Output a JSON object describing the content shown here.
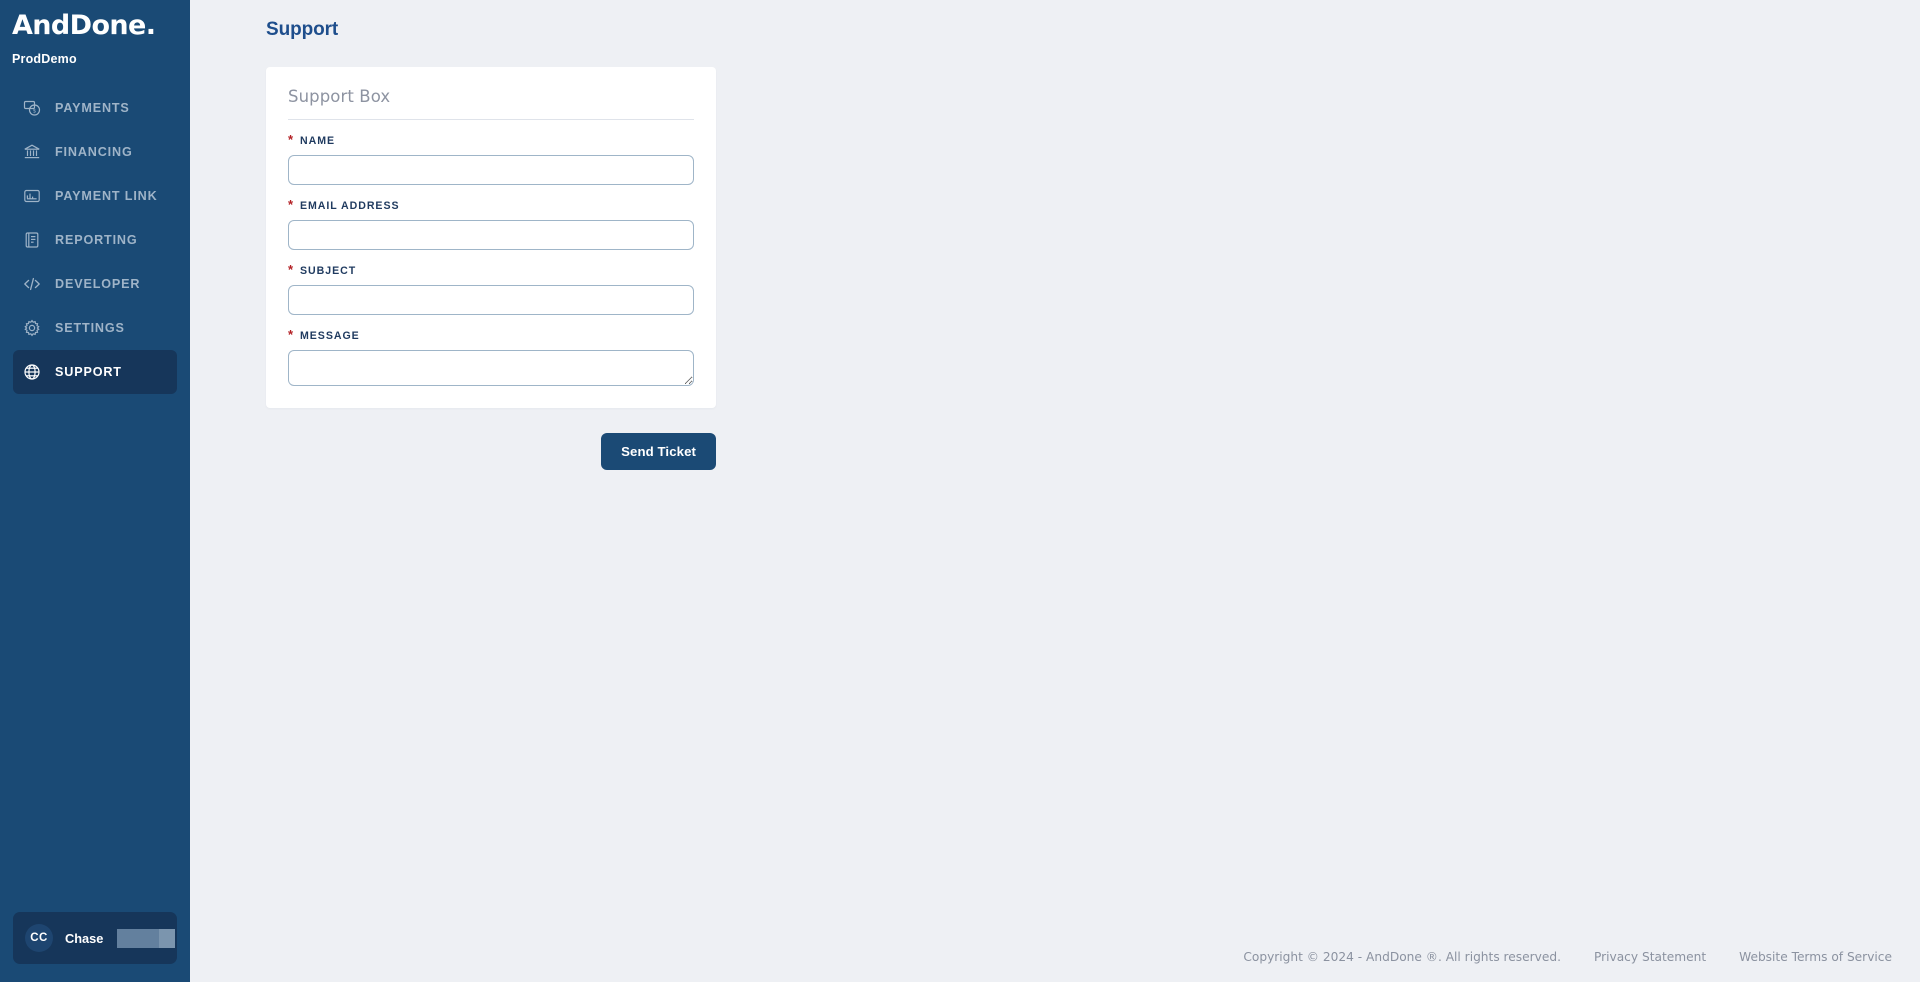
{
  "sidebar": {
    "logo": "AndDone.",
    "org_name": "ProdDemo",
    "items": [
      {
        "label": "PAYMENTS",
        "icon": "payments-icon",
        "active": false
      },
      {
        "label": "FINANCING",
        "icon": "bank-icon",
        "active": false
      },
      {
        "label": "PAYMENT LINK",
        "icon": "payment-link-icon",
        "active": false
      },
      {
        "label": "REPORTING",
        "icon": "report-icon",
        "active": false
      },
      {
        "label": "DEVELOPER",
        "icon": "code-icon",
        "active": false
      },
      {
        "label": "SETTINGS",
        "icon": "gear-icon",
        "active": false
      },
      {
        "label": "SUPPORT",
        "icon": "globe-icon",
        "active": true
      }
    ],
    "profile": {
      "initials": "CC",
      "name": "Chase",
      "redacted": ""
    }
  },
  "main": {
    "page_title": "Support",
    "card": {
      "title": "Support Box",
      "fields": [
        {
          "label": "NAME",
          "required": "*",
          "value": "",
          "placeholder": ""
        },
        {
          "label": "EMAIL ADDRESS",
          "required": "*",
          "value": "",
          "placeholder": ""
        },
        {
          "label": "SUBJECT",
          "required": "*",
          "value": "",
          "placeholder": ""
        },
        {
          "label": "MESSAGE",
          "required": "*",
          "value": "",
          "placeholder": ""
        }
      ]
    },
    "submit_label": "Send Ticket"
  },
  "footer": {
    "copyright": "Copyright © 2024 - AndDone ®. All rights reserved.",
    "privacy_link": "Privacy Statement",
    "terms_link": "Website Terms of Service"
  },
  "colors": {
    "sidebar_bg": "#1a4a75",
    "sidebar_active": "#16365a",
    "page_bg": "#eef0f4",
    "accent": "#1b4a75",
    "required": "#b32025",
    "title": "#1e4e8c"
  }
}
